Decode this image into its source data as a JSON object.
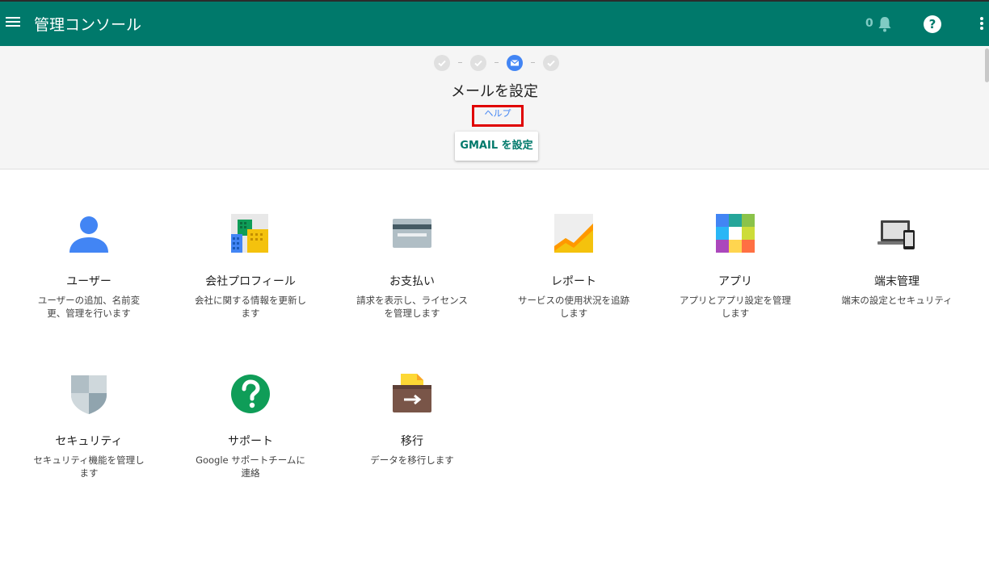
{
  "header": {
    "title": "管理コンソール",
    "notification_count": "0",
    "help_symbol": "?"
  },
  "setup": {
    "title": "メールを設定",
    "help_link": "ヘルプ",
    "button_label": "GMAIL を設定",
    "steps": [
      "done",
      "done",
      "current",
      "done"
    ]
  },
  "tiles": [
    {
      "label": "ユーザー",
      "desc": "ユーザーの追加、名前変更、管理を行います",
      "icon": "user-icon"
    },
    {
      "label": "会社プロフィール",
      "desc": "会社に関する情報を更新します",
      "icon": "building-icon"
    },
    {
      "label": "お支払い",
      "desc": "請求を表示し、ライセンスを管理します",
      "icon": "credit-card-icon"
    },
    {
      "label": "レポート",
      "desc": "サービスの使用状況を追跡します",
      "icon": "report-chart-icon"
    },
    {
      "label": "アプリ",
      "desc": "アプリとアプリ設定を管理します",
      "icon": "apps-grid-icon"
    },
    {
      "label": "端末管理",
      "desc": "端末の設定とセキュリティ",
      "icon": "devices-icon"
    },
    {
      "label": "セキュリティ",
      "desc": "セキュリティ機能を管理します",
      "icon": "shield-icon"
    },
    {
      "label": "サポート",
      "desc": "Google サポートチームに連絡",
      "icon": "support-question-icon"
    },
    {
      "label": "移行",
      "desc": "データを移行します",
      "icon": "migration-box-icon"
    }
  ],
  "colors": {
    "header": "#00796b",
    "accent_blue": "#4285f4",
    "highlight_red": "#e00000"
  }
}
